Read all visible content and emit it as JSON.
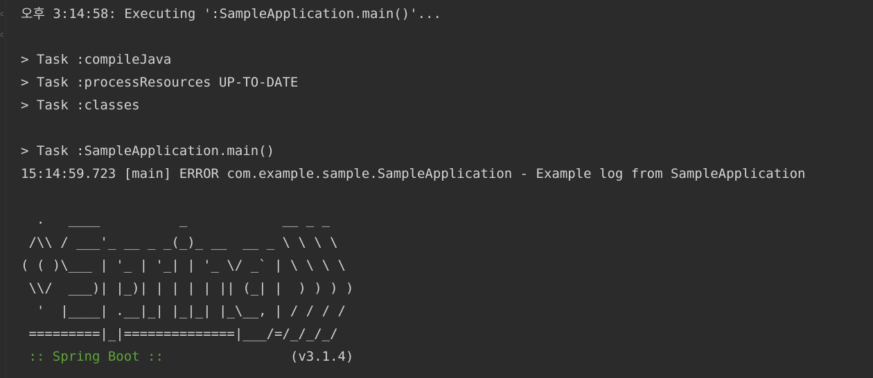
{
  "gutter": {
    "marks": [
      "c",
      "c"
    ]
  },
  "console": {
    "lines": [
      "오후 3:14:58: Executing ':SampleApplication.main()'...",
      "",
      "> Task :compileJava",
      "> Task :processResources UP-TO-DATE",
      "> Task :classes",
      "",
      "> Task :SampleApplication.main()",
      "15:14:59.723 [main] ERROR com.example.sample.SampleApplication - Example log from SampleApplication",
      "",
      "  .   ____          _            __ _ _",
      " /\\\\ / ___'_ __ _ _(_)_ __  __ _ \\ \\ \\ \\",
      "( ( )\\___ | '_ | '_| | '_ \\/ _` | \\ \\ \\ \\",
      " \\\\/  ___)| |_)| | | | | || (_| |  ) ) ) )",
      "  '  |____| .__|_| |_|_| |_\\__, | / / / /",
      " =========|_|==============|___/=/_/_/_/"
    ],
    "spring_boot_label": " :: Spring Boot :: ",
    "spring_boot_version": "               (v3.1.4)"
  },
  "colors": {
    "background": "#2b2b2b",
    "text": "#d4d4d4",
    "spring_green": "#5ea33a"
  }
}
